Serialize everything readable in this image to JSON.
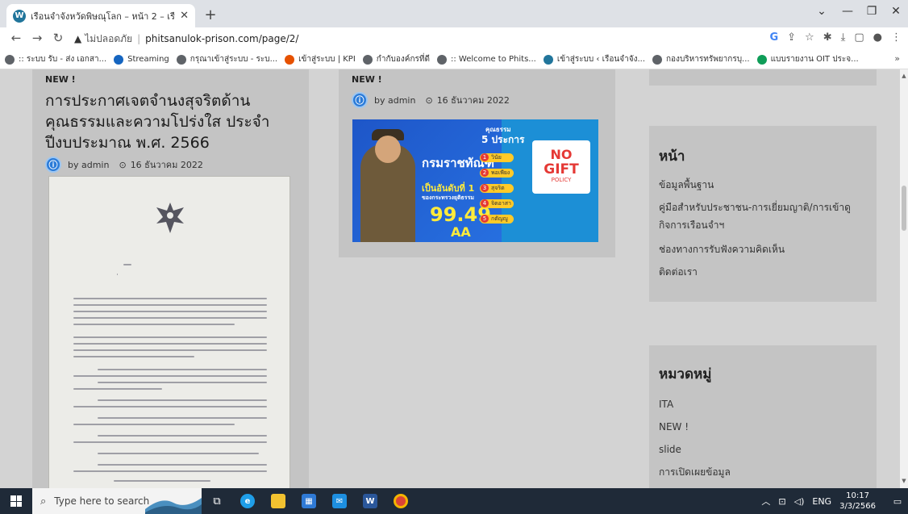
{
  "browser": {
    "tab_title": "เรือนจำจังหวัดพิษณุโลก – หน้า 2 – เรือ",
    "new_tab": "+",
    "url_warning": "ไม่ปลอดภัย",
    "url": "phitsanulok-prison.com/page/2/"
  },
  "bookmarks": [
    {
      "label": ":: ระบบ รับ - ส่ง เอกสา...",
      "color": "#5f6368",
      "icon": "globe-icon"
    },
    {
      "label": "Streaming",
      "color": "#1565c0",
      "icon": "streaming-icon"
    },
    {
      "label": "กรุณาเข้าสู่ระบบ - ระบ...",
      "color": "#5f6368",
      "icon": "globe-icon"
    },
    {
      "label": "เข้าสู่ระบบ | KPI",
      "color": "#e65100",
      "icon": "kpi-icon"
    },
    {
      "label": "กำกับองค์กรที่ดี",
      "color": "#5f6368",
      "icon": "globe-icon"
    },
    {
      "label": ":: Welcome to Phits...",
      "color": "#5f6368",
      "icon": "globe-icon"
    },
    {
      "label": "เข้าสู่ระบบ ‹ เรือนจำจัง...",
      "color": "#21759b",
      "icon": "wordpress-icon"
    },
    {
      "label": "กองบริหารทรัพยากรบุ...",
      "color": "#5f6368",
      "icon": "globe-icon"
    },
    {
      "label": "แบบรายงาน OIT ประจ...",
      "color": "#0f9d58",
      "icon": "sheet-icon"
    }
  ],
  "bookmarks_more": "»",
  "posts": [
    {
      "label": "NEW !",
      "title_lines": [
        "การประกาศเจตจำนงสุจริตด้าน",
        "คุณธรรมและความโปร่งใส ประจำ",
        "ปีงบประมาณ พ.ศ. 2566"
      ],
      "author": "by admin",
      "date": "16 ธันวาคม 2022"
    },
    {
      "label": "NEW !",
      "author": "by admin",
      "date": "16 ธันวาคม 2022"
    }
  ],
  "banner": {
    "headline": "กรมราชทัณฑ์",
    "rank_text": "เป็นอันดับที่ 1",
    "rank_sub": "ของกระทรวงยุติธรรม",
    "score": "99.49",
    "grade": "AA",
    "virtues_title": "คุณธรรม",
    "virtues_sub": "5 ประการ",
    "virtues": [
      "วินัย",
      "พอเพียง",
      "สุจริต",
      "จิตอาสา",
      "กตัญญู"
    ],
    "no_text": "NO",
    "gift_text": "GIFT",
    "policy_text": "POLICY"
  },
  "sidebar": {
    "pages_title": "หน้า",
    "pages": [
      "ข้อมูลพื้นฐาน",
      "คู่มือสำหรับประชาชน-การเยี่ยมญาติ/การเข้าดูกิจการเรือนจำฯ",
      "ช่องทางการรับฟังความคิดเห็น",
      "ติดต่อเรา"
    ],
    "categories_title": "หมวดหมู่",
    "categories": [
      "ITA",
      "NEW !",
      "slide",
      "การเปิดเผยข้อมูล"
    ]
  },
  "taskbar": {
    "search_placeholder": "Type here to search",
    "lang": "ENG",
    "time": "10:17",
    "date": "3/3/2566"
  }
}
